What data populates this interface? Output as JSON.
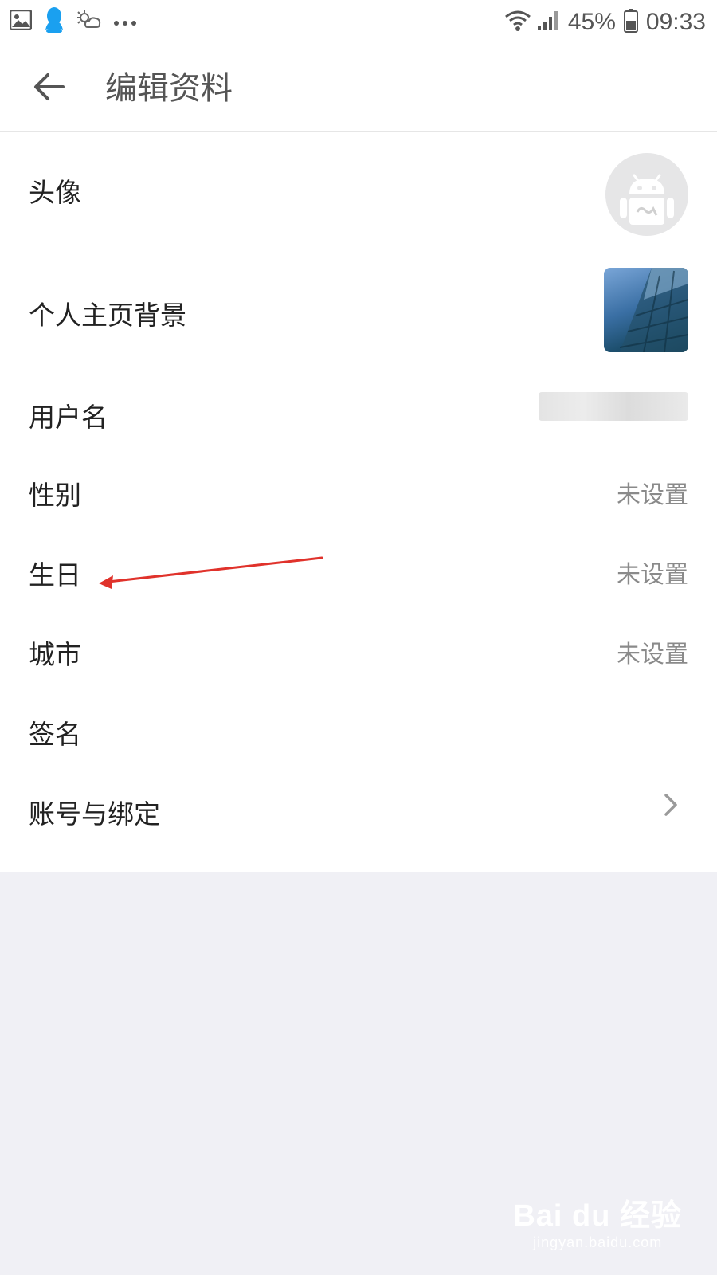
{
  "status_bar": {
    "battery_percent": "45%",
    "time": "09:33",
    "icons": [
      "gallery-icon",
      "qq-icon",
      "weather-icon",
      "more-dots-icon",
      "wifi-icon",
      "signal-icon",
      "battery-icon"
    ]
  },
  "toolbar": {
    "title": "编辑资料",
    "back_icon": "back-arrow-icon"
  },
  "rows": {
    "avatar": {
      "label": "头像"
    },
    "background": {
      "label": "个人主页背景"
    },
    "username": {
      "label": "用户名"
    },
    "gender": {
      "label": "性别",
      "value": "未设置"
    },
    "birthday": {
      "label": "生日",
      "value": "未设置"
    },
    "city": {
      "label": "城市",
      "value": "未设置"
    },
    "signature": {
      "label": "签名"
    },
    "account": {
      "label": "账号与绑定"
    }
  },
  "colors": {
    "annotation_arrow": "#e0322b",
    "page_background": "#f0f0f5",
    "value_text": "#8a8a8a"
  },
  "watermark": {
    "logo_text": "Bai du 经验",
    "url": "jingyan.baidu.com"
  }
}
